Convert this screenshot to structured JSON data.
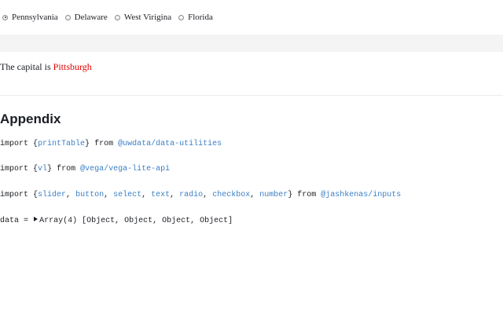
{
  "radio_group": {
    "options": [
      {
        "label": "Pennsylvania",
        "checked": true
      },
      {
        "label": "Delaware",
        "checked": false
      },
      {
        "label": "West Virigina",
        "checked": false
      },
      {
        "label": "Florida",
        "checked": false
      }
    ]
  },
  "capital": {
    "prefix": "The capital is",
    "city": "Pittsburgh",
    "city_color": "#e00000"
  },
  "appendix": {
    "title": "Appendix",
    "imports": [
      {
        "keyword": "import",
        "names": [
          "printTable"
        ],
        "from": "from",
        "module": "@uwdata/data-utilities"
      },
      {
        "keyword": "import",
        "names": [
          "vl"
        ],
        "from": "from",
        "module": "@vega/vega-lite-api"
      },
      {
        "keyword": "import",
        "names": [
          "slider",
          "button",
          "select",
          "text",
          "radio",
          "checkbox",
          "number"
        ],
        "from": "from",
        "module": "@jashkenas/inputs"
      }
    ],
    "data_cell": {
      "name": "data",
      "operator": "=",
      "summary": "Array(4)",
      "preview": "[Object, Object, Object, Object]"
    }
  },
  "colors": {
    "identifier": "#3b7fc4",
    "band": "#f4f4f4",
    "text": "#1b1e23"
  }
}
